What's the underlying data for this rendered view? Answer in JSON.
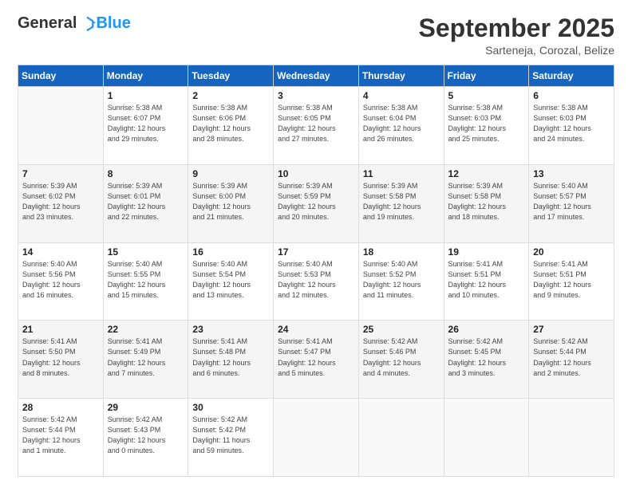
{
  "logo": {
    "general": "General",
    "blue": "Blue"
  },
  "title": "September 2025",
  "location": "Sarteneja, Corozal, Belize",
  "days_of_week": [
    "Sunday",
    "Monday",
    "Tuesday",
    "Wednesday",
    "Thursday",
    "Friday",
    "Saturday"
  ],
  "weeks": [
    [
      {
        "day": "",
        "info": ""
      },
      {
        "day": "1",
        "info": "Sunrise: 5:38 AM\nSunset: 6:07 PM\nDaylight: 12 hours\nand 29 minutes."
      },
      {
        "day": "2",
        "info": "Sunrise: 5:38 AM\nSunset: 6:06 PM\nDaylight: 12 hours\nand 28 minutes."
      },
      {
        "day": "3",
        "info": "Sunrise: 5:38 AM\nSunset: 6:05 PM\nDaylight: 12 hours\nand 27 minutes."
      },
      {
        "day": "4",
        "info": "Sunrise: 5:38 AM\nSunset: 6:04 PM\nDaylight: 12 hours\nand 26 minutes."
      },
      {
        "day": "5",
        "info": "Sunrise: 5:38 AM\nSunset: 6:03 PM\nDaylight: 12 hours\nand 25 minutes."
      },
      {
        "day": "6",
        "info": "Sunrise: 5:38 AM\nSunset: 6:03 PM\nDaylight: 12 hours\nand 24 minutes."
      }
    ],
    [
      {
        "day": "7",
        "info": "Sunrise: 5:39 AM\nSunset: 6:02 PM\nDaylight: 12 hours\nand 23 minutes."
      },
      {
        "day": "8",
        "info": "Sunrise: 5:39 AM\nSunset: 6:01 PM\nDaylight: 12 hours\nand 22 minutes."
      },
      {
        "day": "9",
        "info": "Sunrise: 5:39 AM\nSunset: 6:00 PM\nDaylight: 12 hours\nand 21 minutes."
      },
      {
        "day": "10",
        "info": "Sunrise: 5:39 AM\nSunset: 5:59 PM\nDaylight: 12 hours\nand 20 minutes."
      },
      {
        "day": "11",
        "info": "Sunrise: 5:39 AM\nSunset: 5:58 PM\nDaylight: 12 hours\nand 19 minutes."
      },
      {
        "day": "12",
        "info": "Sunrise: 5:39 AM\nSunset: 5:58 PM\nDaylight: 12 hours\nand 18 minutes."
      },
      {
        "day": "13",
        "info": "Sunrise: 5:40 AM\nSunset: 5:57 PM\nDaylight: 12 hours\nand 17 minutes."
      }
    ],
    [
      {
        "day": "14",
        "info": "Sunrise: 5:40 AM\nSunset: 5:56 PM\nDaylight: 12 hours\nand 16 minutes."
      },
      {
        "day": "15",
        "info": "Sunrise: 5:40 AM\nSunset: 5:55 PM\nDaylight: 12 hours\nand 15 minutes."
      },
      {
        "day": "16",
        "info": "Sunrise: 5:40 AM\nSunset: 5:54 PM\nDaylight: 12 hours\nand 13 minutes."
      },
      {
        "day": "17",
        "info": "Sunrise: 5:40 AM\nSunset: 5:53 PM\nDaylight: 12 hours\nand 12 minutes."
      },
      {
        "day": "18",
        "info": "Sunrise: 5:40 AM\nSunset: 5:52 PM\nDaylight: 12 hours\nand 11 minutes."
      },
      {
        "day": "19",
        "info": "Sunrise: 5:41 AM\nSunset: 5:51 PM\nDaylight: 12 hours\nand 10 minutes."
      },
      {
        "day": "20",
        "info": "Sunrise: 5:41 AM\nSunset: 5:51 PM\nDaylight: 12 hours\nand 9 minutes."
      }
    ],
    [
      {
        "day": "21",
        "info": "Sunrise: 5:41 AM\nSunset: 5:50 PM\nDaylight: 12 hours\nand 8 minutes."
      },
      {
        "day": "22",
        "info": "Sunrise: 5:41 AM\nSunset: 5:49 PM\nDaylight: 12 hours\nand 7 minutes."
      },
      {
        "day": "23",
        "info": "Sunrise: 5:41 AM\nSunset: 5:48 PM\nDaylight: 12 hours\nand 6 minutes."
      },
      {
        "day": "24",
        "info": "Sunrise: 5:41 AM\nSunset: 5:47 PM\nDaylight: 12 hours\nand 5 minutes."
      },
      {
        "day": "25",
        "info": "Sunrise: 5:42 AM\nSunset: 5:46 PM\nDaylight: 12 hours\nand 4 minutes."
      },
      {
        "day": "26",
        "info": "Sunrise: 5:42 AM\nSunset: 5:45 PM\nDaylight: 12 hours\nand 3 minutes."
      },
      {
        "day": "27",
        "info": "Sunrise: 5:42 AM\nSunset: 5:44 PM\nDaylight: 12 hours\nand 2 minutes."
      }
    ],
    [
      {
        "day": "28",
        "info": "Sunrise: 5:42 AM\nSunset: 5:44 PM\nDaylight: 12 hours\nand 1 minute."
      },
      {
        "day": "29",
        "info": "Sunrise: 5:42 AM\nSunset: 5:43 PM\nDaylight: 12 hours\nand 0 minutes."
      },
      {
        "day": "30",
        "info": "Sunrise: 5:42 AM\nSunset: 5:42 PM\nDaylight: 11 hours\nand 59 minutes."
      },
      {
        "day": "",
        "info": ""
      },
      {
        "day": "",
        "info": ""
      },
      {
        "day": "",
        "info": ""
      },
      {
        "day": "",
        "info": ""
      }
    ]
  ]
}
